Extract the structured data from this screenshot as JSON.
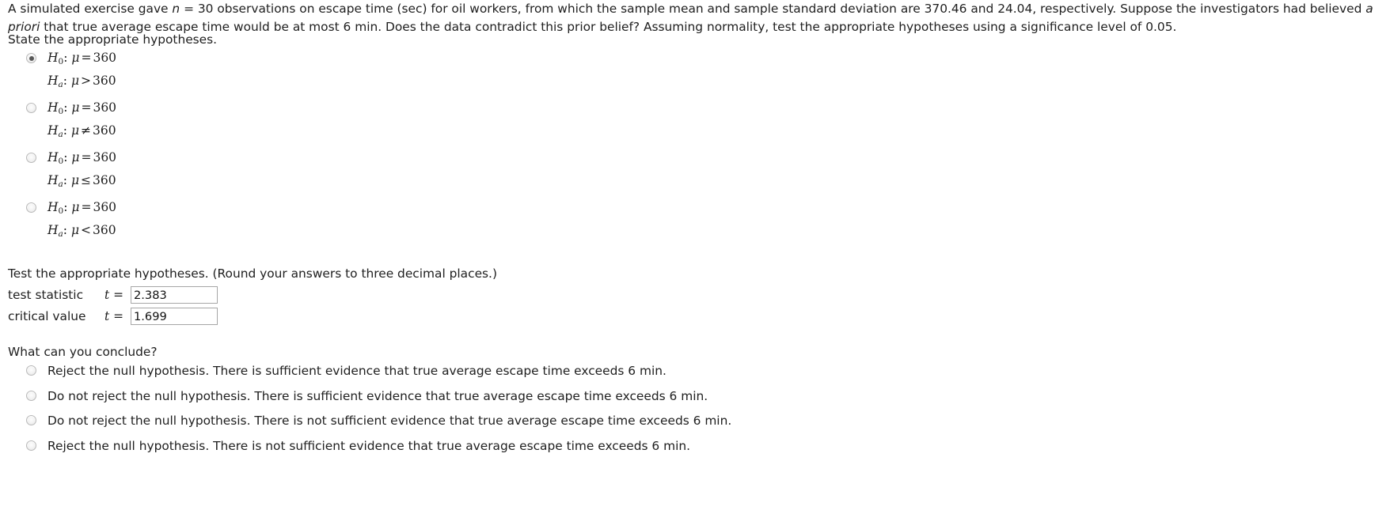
{
  "problem": {
    "paragraph_part1": "A simulated exercise gave ",
    "n_symbol": "n",
    "paragraph_part2": " = 30 observations on escape time (sec) for oil workers, from which the sample mean and sample standard deviation are 370.46 and 24.04, respectively. Suppose the investigators had believed ",
    "a_priori": "a priori",
    "paragraph_part3": " that true average escape time would be at most 6 min. Does the data contradict this prior belief? Assuming normality, test the appropriate hypotheses using a significance level of 0.05.",
    "instruction": "State the appropriate hypotheses.",
    "sample_mean": "370.46",
    "sample_sd": "24.04",
    "n": "30",
    "alpha": "0.05"
  },
  "hypotheses": {
    "selected_index": 0,
    "options": [
      {
        "null_label": "H",
        "null_sub": "0",
        "null_rel": "=",
        "null_value": "360",
        "alt_label": "H",
        "alt_sub": "a",
        "alt_rel": ">",
        "alt_value": "360",
        "mu": "μ",
        "checked": true
      },
      {
        "null_label": "H",
        "null_sub": "0",
        "null_rel": "=",
        "null_value": "360",
        "alt_label": "H",
        "alt_sub": "a",
        "alt_rel": "≠",
        "alt_value": "360",
        "mu": "μ",
        "checked": false
      },
      {
        "null_label": "H",
        "null_sub": "0",
        "null_rel": "=",
        "null_value": "360",
        "alt_label": "H",
        "alt_sub": "a",
        "alt_rel": "≤",
        "alt_value": "360",
        "mu": "μ",
        "checked": false
      },
      {
        "null_label": "H",
        "null_sub": "0",
        "null_rel": "=",
        "null_value": "360",
        "alt_label": "H",
        "alt_sub": "a",
        "alt_rel": "<",
        "alt_value": "360",
        "mu": "μ",
        "checked": false
      }
    ]
  },
  "test_section": {
    "heading": "Test the appropriate hypotheses. (Round your answers to three decimal places.)",
    "rows": [
      {
        "label": "test statistic",
        "symbol_t": "t",
        "equals": " = ",
        "value": "2.383",
        "placeholder": ""
      },
      {
        "label": "critical value",
        "symbol_t": "t",
        "equals": " = ",
        "value": "1.699",
        "placeholder": ""
      }
    ]
  },
  "conclusion": {
    "heading": "What can you conclude?",
    "selected_index": -1,
    "options": [
      {
        "text": "Reject the null hypothesis. There is sufficient evidence that true average escape time exceeds 6 min.",
        "checked": false
      },
      {
        "text": "Do not reject the null hypothesis. There is sufficient evidence that true average escape time exceeds 6 min.",
        "checked": false
      },
      {
        "text": "Do not reject the null hypothesis. There is not sufficient evidence that true average escape time exceeds 6 min.",
        "checked": false
      },
      {
        "text": "Reject the null hypothesis. There is not sufficient evidence that true average escape time exceeds 6 min.",
        "checked": false
      }
    ]
  },
  "colors": {
    "text": "#202020",
    "input_border": "#a6a6a6",
    "radio_dot": "#585858",
    "background": "#ffffff"
  }
}
